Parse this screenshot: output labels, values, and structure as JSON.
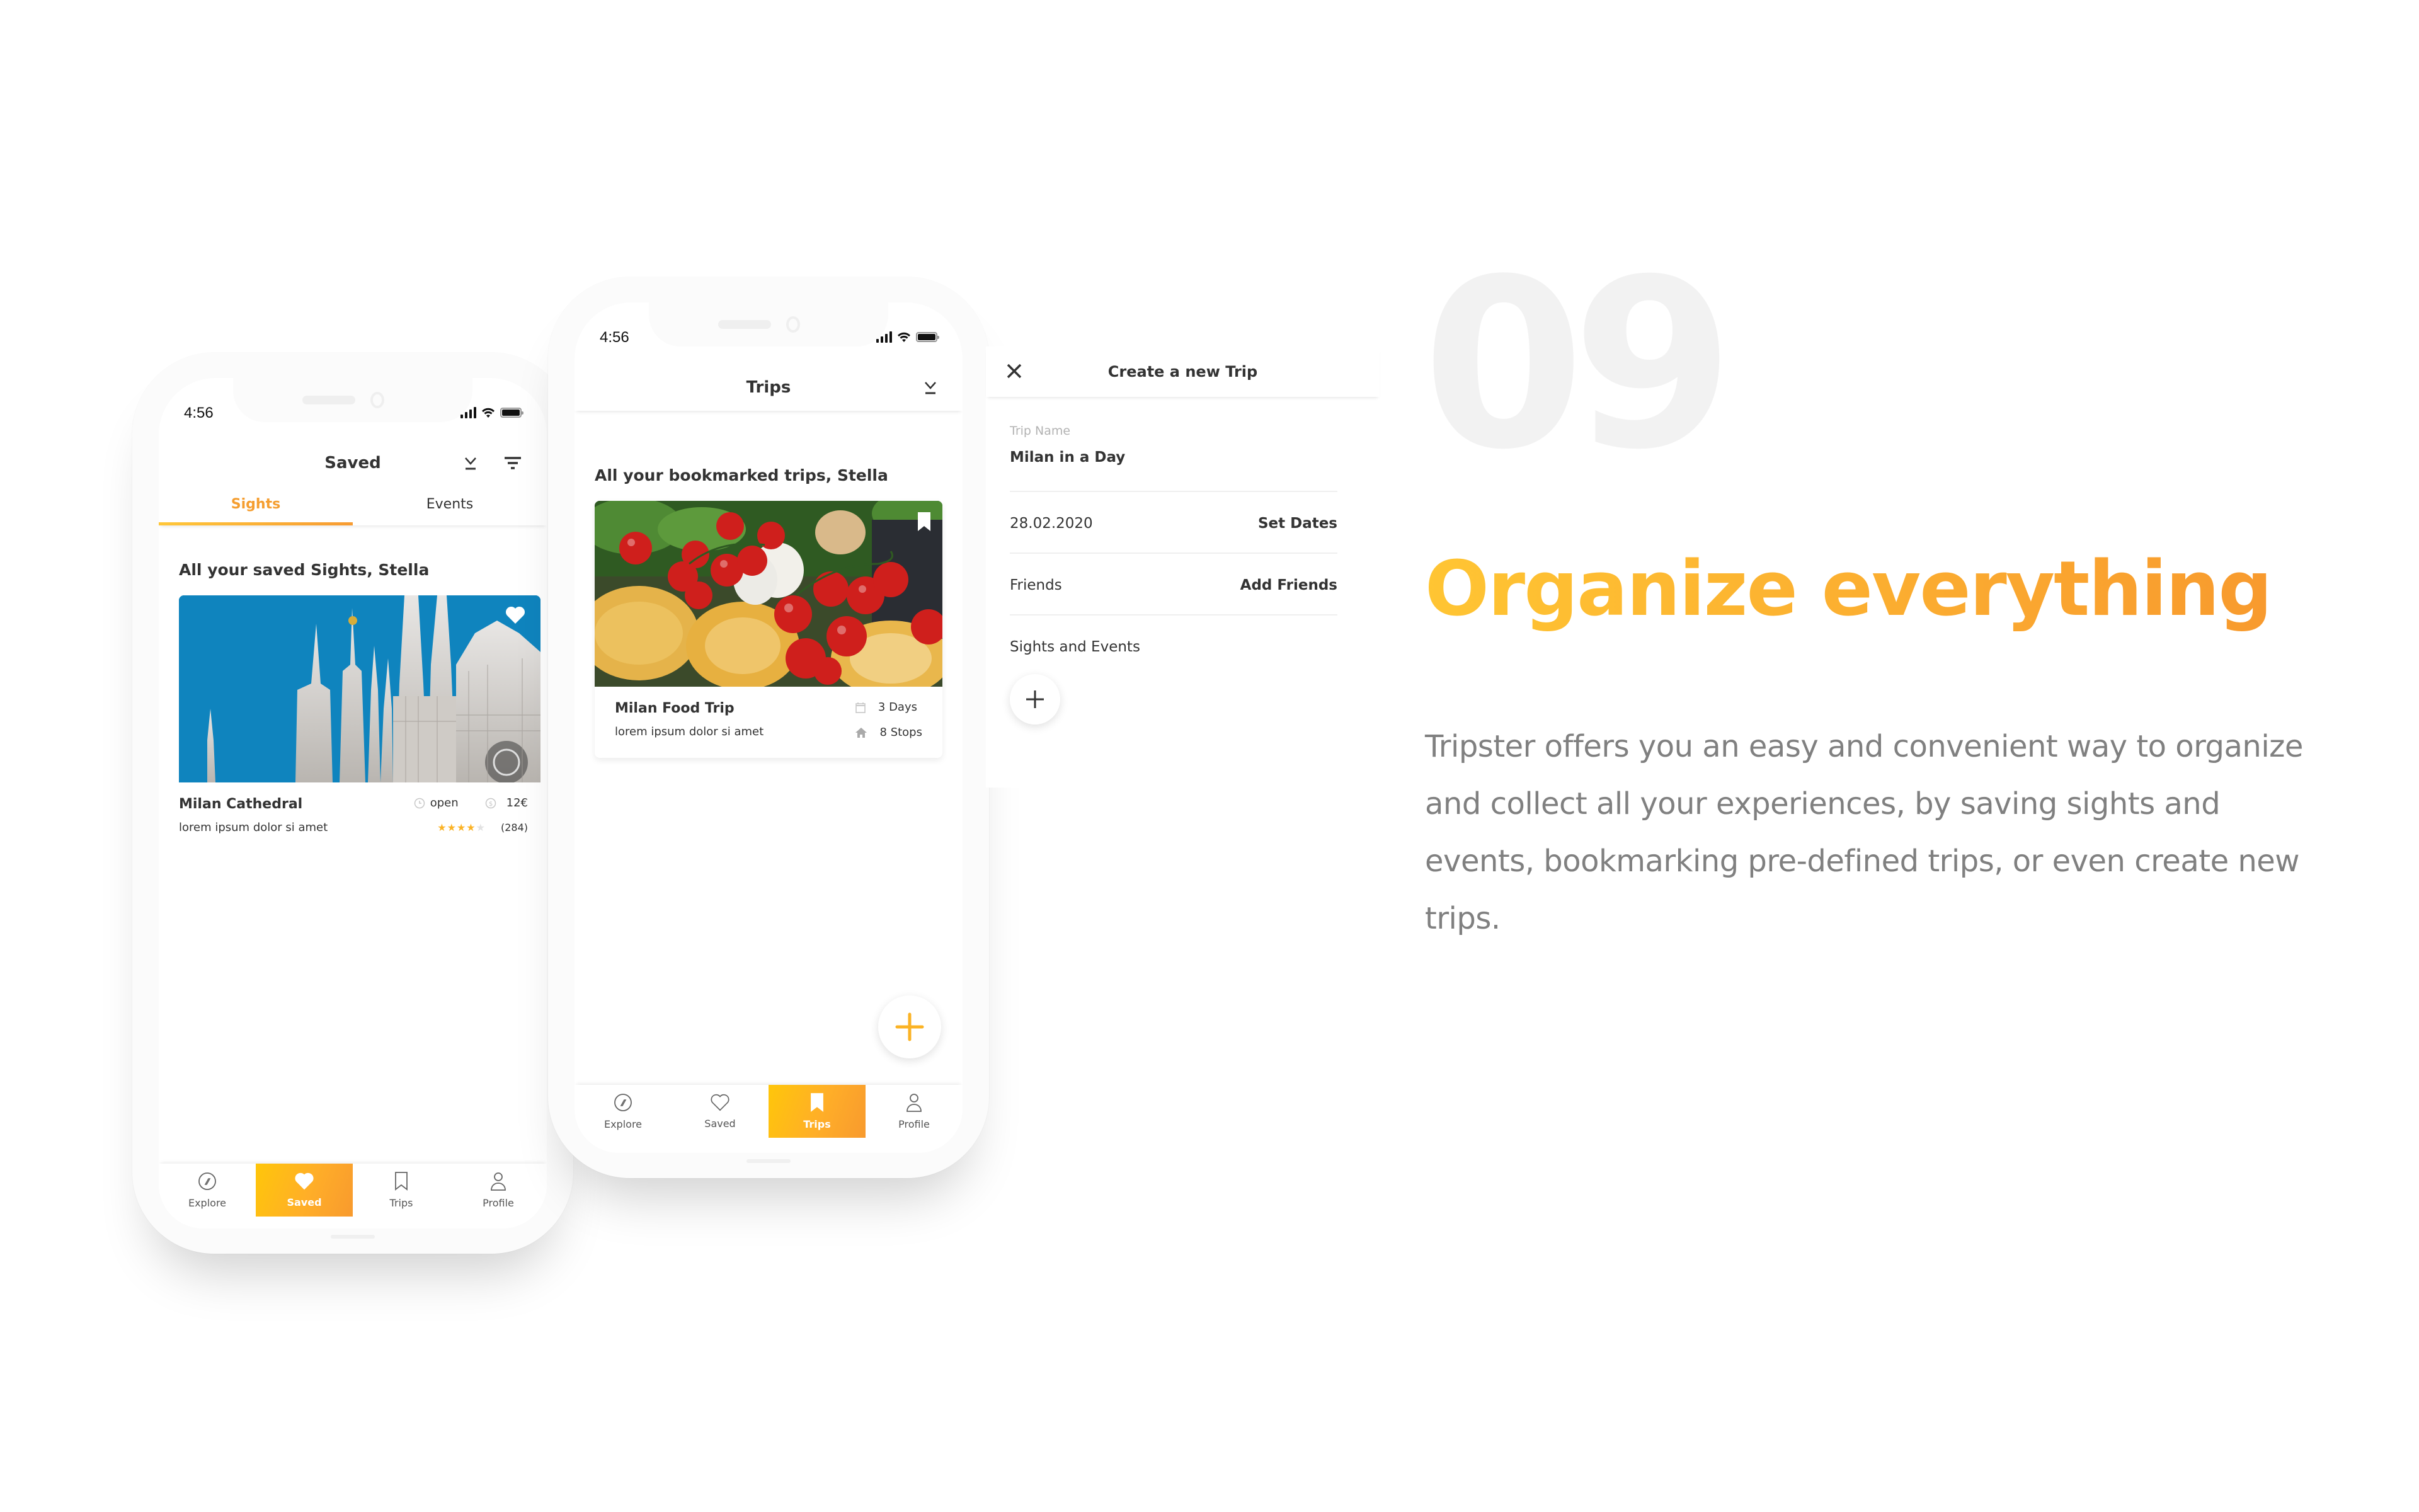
{
  "colors": {
    "accent_start": "#FFC60A",
    "accent_end": "#F89A2E",
    "text_dark": "#333333",
    "text_muted": "#808080",
    "label_light": "#B3B3B3",
    "sky_blue": "#0F84BE"
  },
  "status_bar": {
    "time": "4:56"
  },
  "saved_screen": {
    "title": "Saved",
    "header_icons": [
      "download-icon",
      "filter-icon"
    ],
    "tabs": [
      {
        "label": "Sights",
        "active": true
      },
      {
        "label": "Events",
        "active": false
      }
    ],
    "section_title": "All your saved Sights, Stella",
    "card": {
      "name": "Milan Cathedral",
      "description": "lorem ipsum dolor si amet",
      "status": "open",
      "price": "12€",
      "rating": 4,
      "rating_max": 5,
      "reviews": "(284)",
      "favorited": true,
      "image": "milan-cathedral-photo"
    },
    "nav": [
      {
        "label": "Explore",
        "icon": "compass-icon",
        "active": false
      },
      {
        "label": "Saved",
        "icon": "heart-icon",
        "active": true
      },
      {
        "label": "Trips",
        "icon": "bookmark-icon",
        "active": false
      },
      {
        "label": "Profile",
        "icon": "user-icon",
        "active": false
      }
    ]
  },
  "trips_screen": {
    "title": "Trips",
    "header_icons": [
      "download-icon"
    ],
    "section_title": "All your bookmarked trips, Stella",
    "card": {
      "name": "Milan Food Trip",
      "description": "lorem ipsum dolor si amet",
      "duration": "3 Days",
      "stops": "8 Stops",
      "bookmarked": true,
      "image": "italian-food-photo"
    },
    "fab_icon": "plus-icon",
    "nav": [
      {
        "label": "Explore",
        "icon": "compass-icon",
        "active": false
      },
      {
        "label": "Saved",
        "icon": "heart-icon",
        "active": false
      },
      {
        "label": "Trips",
        "icon": "bookmark-icon",
        "active": true
      },
      {
        "label": "Profile",
        "icon": "user-icon",
        "active": false
      }
    ]
  },
  "create_trip": {
    "title": "Create a new Trip",
    "trip_name_label": "Trip Name",
    "trip_name_value": "Milan in a Day",
    "date_value": "28.02.2020",
    "date_action": "Set Dates",
    "friends_label": "Friends",
    "friends_action": "Add Friends",
    "sights_label": "Sights and Events"
  },
  "feature": {
    "number": "09",
    "headline": "Organize everything",
    "description": "Tripster offers you an easy and convenient way to organize and collect all your experiences, by saving sights and events, bookmarking pre-defined trips, or even create new trips."
  }
}
